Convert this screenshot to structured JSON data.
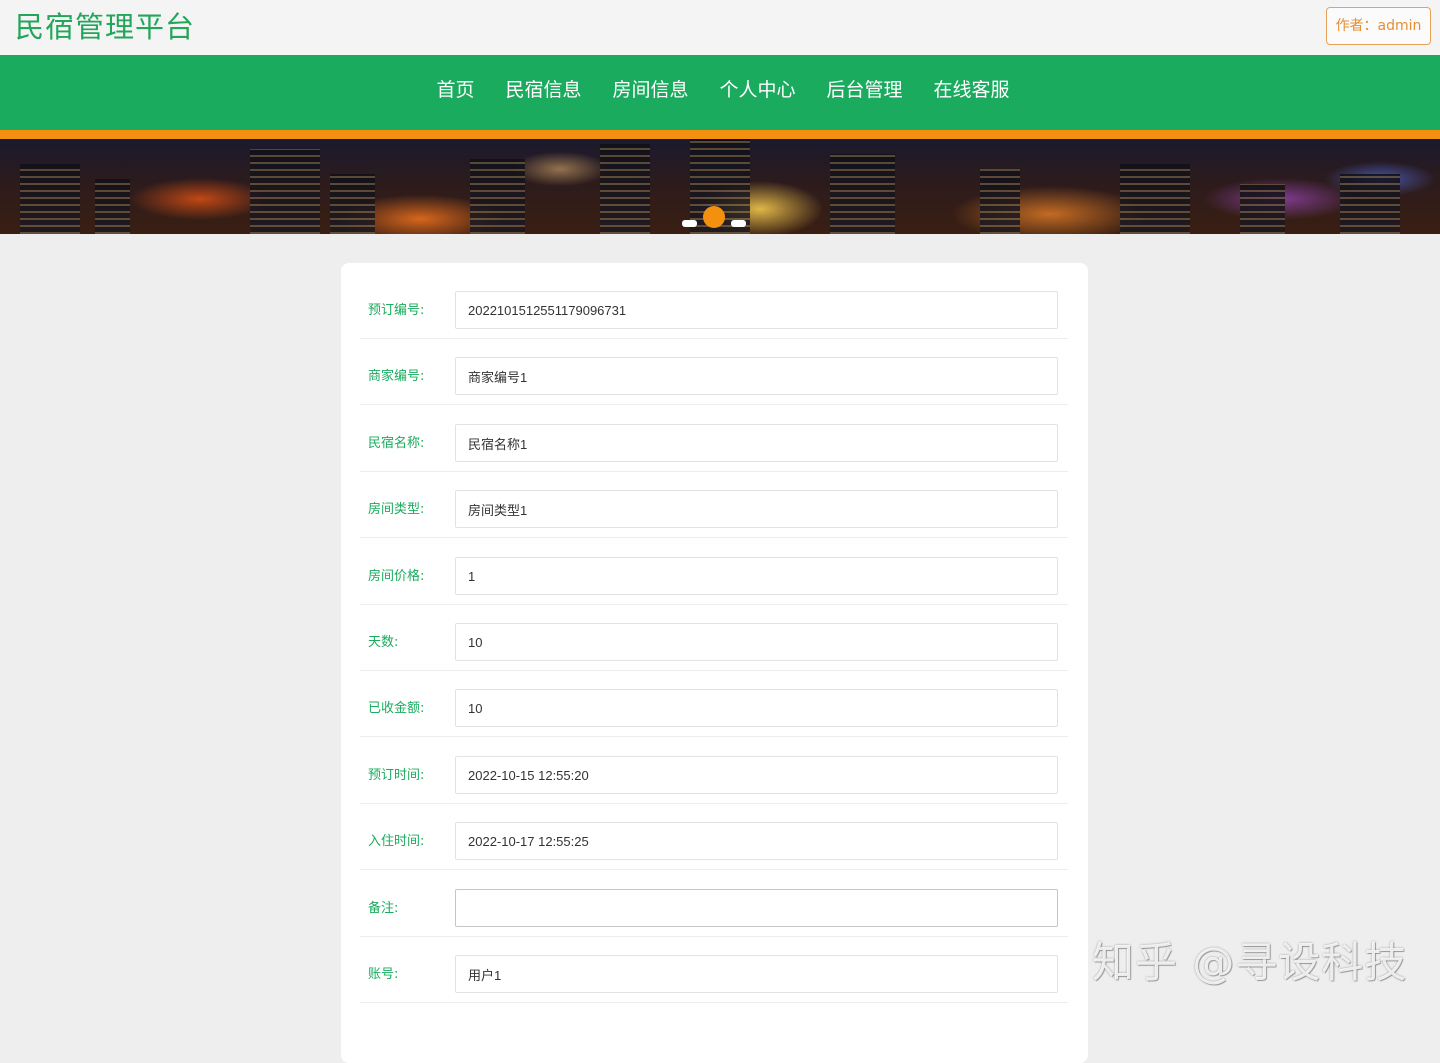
{
  "header": {
    "site_title": "民宿管理平台",
    "author_button": "作者：admin"
  },
  "nav": {
    "items": [
      {
        "label": "首页"
      },
      {
        "label": "民宿信息"
      },
      {
        "label": "房间信息"
      },
      {
        "label": "个人中心"
      },
      {
        "label": "后台管理"
      },
      {
        "label": "在线客服"
      }
    ]
  },
  "banner": {
    "active_slide": 2,
    "slide_count": 3
  },
  "form": {
    "fields": [
      {
        "label": "预订编号:",
        "value": "20221015125511790967​31"
      },
      {
        "label": "商家编号:",
        "value": "商家编号1"
      },
      {
        "label": "民宿名称:",
        "value": "民宿名称1"
      },
      {
        "label": "房间类型:",
        "value": "房间类型1"
      },
      {
        "label": "房间价格:",
        "value": "1"
      },
      {
        "label": "天数:",
        "value": "10"
      },
      {
        "label": "已收金额:",
        "value": "10"
      },
      {
        "label": "预订时间:",
        "value": "2022-10-15 12:55:20"
      },
      {
        "label": "入住时间:",
        "value": "2022-10-17 12:55:25"
      },
      {
        "label": "备注:",
        "value": ""
      },
      {
        "label": "账号:",
        "value": "用户1"
      }
    ]
  },
  "watermark": "知乎 @寻设科技",
  "colors": {
    "brand_green": "#1aab5e",
    "accent_orange": "#f3900f"
  }
}
